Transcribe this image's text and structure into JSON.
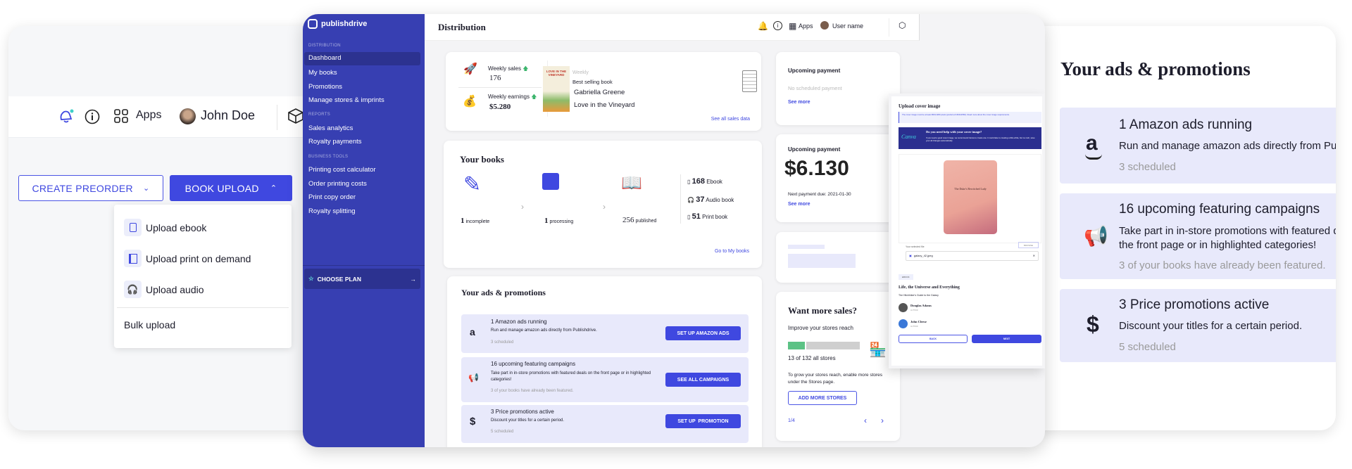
{
  "left_panel": {
    "header": {
      "apps_label": "Apps",
      "user_name": "John Doe",
      "icons": [
        "bell-icon",
        "info-icon",
        "apps-grid-icon",
        "cube-icon"
      ]
    },
    "create_preorder_label": "CREATE PREORDER",
    "book_upload_label": "BOOK UPLOAD",
    "dropdown": {
      "items": [
        {
          "label": "Upload ebook",
          "icon": "tablet-icon"
        },
        {
          "label": "Upload print on demand",
          "icon": "book-icon"
        },
        {
          "label": "Upload audio",
          "icon": "headphones-icon"
        }
      ],
      "bulk_upload": "Bulk upload"
    }
  },
  "app": {
    "brand": "publishdrive",
    "sidebar": {
      "sections": [
        {
          "title": "DISTRIBUTION",
          "items": [
            "Dashboard",
            "My books",
            "Promotions",
            "Manage stores & imprints"
          ]
        },
        {
          "title": "REPORTS",
          "items": [
            "Sales analytics",
            "Royalty payments"
          ]
        },
        {
          "title": "BUSINESS TOOLS",
          "items": [
            "Printing cost calculator",
            "Order printing costs",
            "Print copy order",
            "Royalty splitting"
          ]
        }
      ],
      "active": "Dashboard",
      "choose_plan": "CHOOSE PLAN"
    },
    "header": {
      "title": "Distribution",
      "apps_label": "Apps",
      "user_name": "User name"
    },
    "sales_card": {
      "weekly_sales_label": "Weekly sales",
      "weekly_sales": "176",
      "weekly_earnings_label": "Weekly earnings",
      "weekly_earnings": "$5.280",
      "weekly_label": "Weekly",
      "best_selling_label": "Best selling book",
      "author": "Gabriella Greene",
      "book_title": "Love in the Vineyard",
      "cover_text": "LOVE IN THE VINEYARD",
      "see_all": "See all sales data"
    },
    "books_card": {
      "title": "Your books",
      "steps": [
        {
          "count": "1",
          "label": "incomplete"
        },
        {
          "count": "1",
          "label": "processing"
        },
        {
          "count": "256",
          "label": "published"
        }
      ],
      "formats": [
        {
          "count": "168",
          "label": "Ebook",
          "icon": "tablet-icon"
        },
        {
          "count": "37",
          "label": "Audio book",
          "icon": "headphones-icon"
        },
        {
          "count": "51",
          "label": "Print book",
          "icon": "book-icon"
        }
      ],
      "link": "Go to My books"
    },
    "promo_card": {
      "title": "Your ads & promotions",
      "rows": [
        {
          "title": "1 Amazon ads running",
          "desc": "Run and manage amazon ads directly from Publishdrive.",
          "sub": "3 scheduled",
          "button": "SET UP AMAZON ADS",
          "icon": "amazon-icon"
        },
        {
          "title": "16 upcoming featuring campaigns",
          "desc": "Take part in in-store promotions with featured deals on the front page or in highlighted categories!",
          "sub": "3 of your books have already been featured.",
          "button": "SEE ALL CAMPAIGNS",
          "icon": "megaphone-icon"
        },
        {
          "title": "3 Price promotions active",
          "desc": "Discount your titles for a certain period.",
          "sub": "5 scheduled",
          "button": "SET UP  PROMOTION",
          "icon": "dollar-icon"
        }
      ]
    },
    "payment_empty": {
      "title": "Upcoming payment",
      "empty": "No scheduled payment",
      "link": "See more"
    },
    "payment": {
      "title": "Upcoming payment",
      "amount": "$6.130",
      "due": "Next payment due: 2021-01-30",
      "link": "See more"
    },
    "stores_card": {
      "title": "Want more sales?",
      "subtitle": "Improve your stores reach",
      "enabled": 13,
      "total": 132,
      "bar_fill": 0.25,
      "count_label": "13 of 132 all stores",
      "desc": "To grow your stores reach, enable more stores under the Stores page.",
      "button": "ADD MORE STORES",
      "pager": "1/4"
    },
    "upload_modal": {
      "title": "Upload cover image",
      "info": "The cover image must be at least 800x1280 pixels (preferred 1600x2560). Read more about the cover image requirements.",
      "canva_logo": "Canva",
      "canva_title": "Do you need help with your cover image?",
      "canva_text": "If you need a good cover image, we recommend Canva to create one. It could take to creating a little while, but no rush, save your all changes automatically.",
      "cover_text": "The Duke's Bewitched Lady",
      "selected_label": "Your selected file",
      "browse": "BROWSE",
      "file_name": "galaxy_42.jpeg",
      "chip": "EBOOK",
      "book_title": "Life, the Universe and Everything",
      "series": "The Hitchhiker's Guide to the Galaxy",
      "contributors": [
        {
          "name": "Douglas Adams",
          "role": "AUTHOR"
        },
        {
          "name": "John Cleese",
          "role": "AUTHOR"
        }
      ],
      "back": "BACK",
      "next": "NEXT"
    }
  },
  "right_panel": {
    "title": "Your ads & promotions",
    "rows": [
      {
        "title": "1 Amazon ads running",
        "desc": "Run and manage amazon ads directly from Publishdrive.",
        "sub": "3 scheduled",
        "icon": "amazon-icon"
      },
      {
        "title": "16 upcoming featuring campaigns",
        "desc": "Take part in in-store promotions with featured deals on the front page or in highlighted categories!",
        "sub": "3 of your books have already been featured.",
        "icon": "megaphone-icon"
      },
      {
        "title": "3 Price promotions active",
        "desc": "Discount your titles for a certain period.",
        "sub": "5 scheduled",
        "icon": "dollar-icon"
      }
    ]
  },
  "colors": {
    "brand_blue": "#3f48e0",
    "sidebar": "#373fb2",
    "promo_bg": "#e8e9fb",
    "success_green": "#5cc285",
    "canva_banner": "#2b2f8f"
  }
}
